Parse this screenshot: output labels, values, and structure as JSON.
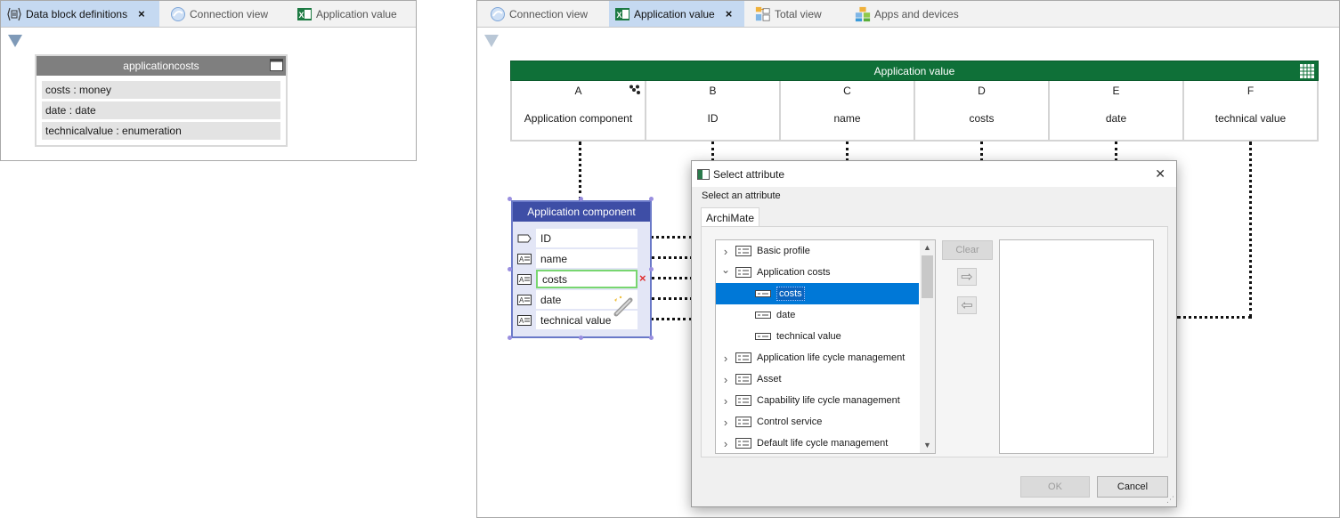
{
  "left_panel": {
    "tabs": [
      {
        "label": "Data block definitions",
        "active": true,
        "close": "×"
      },
      {
        "label": "Connection view",
        "active": false
      },
      {
        "label": "Application value",
        "active": false
      }
    ],
    "data_block": {
      "title": "applicationcosts",
      "rows": [
        "costs : money",
        "date : date",
        "technicalvalue : enumeration"
      ]
    }
  },
  "right_panel": {
    "tabs": [
      {
        "label": "Connection view",
        "active": false
      },
      {
        "label": "Application value",
        "active": true,
        "close": "×"
      },
      {
        "label": "Total view",
        "active": false
      },
      {
        "label": "Apps and devices",
        "active": false
      }
    ],
    "app_value_table": {
      "title": "Application value",
      "columns": [
        {
          "letter": "A",
          "label": "Application component"
        },
        {
          "letter": "B",
          "label": "ID"
        },
        {
          "letter": "C",
          "label": "name"
        },
        {
          "letter": "D",
          "label": "costs"
        },
        {
          "letter": "E",
          "label": "date"
        },
        {
          "letter": "F",
          "label": "technical value"
        }
      ]
    },
    "app_component": {
      "title": "Application component",
      "rows": [
        "ID",
        "name",
        "costs",
        "date",
        "technical value"
      ],
      "selected_row": "costs",
      "remove_mark": "×"
    }
  },
  "dialog": {
    "title": "Select attribute",
    "close": "✕",
    "instruction": "Select an attribute",
    "tab": "ArchiMate",
    "tree": [
      {
        "label": "Basic profile",
        "expander": "›",
        "level": 0
      },
      {
        "label": "Application costs",
        "expander": "⌄",
        "level": 0
      },
      {
        "label": "costs",
        "level": 1,
        "selected": true
      },
      {
        "label": "date",
        "level": 1
      },
      {
        "label": "technical value",
        "level": 1
      },
      {
        "label": "Application life cycle management",
        "expander": "›",
        "level": 0
      },
      {
        "label": "Asset",
        "expander": "›",
        "level": 0
      },
      {
        "label": "Capability life cycle management",
        "expander": "›",
        "level": 0
      },
      {
        "label": "Control service",
        "expander": "›",
        "level": 0
      },
      {
        "label": "Default life cycle management",
        "expander": "›",
        "level": 0
      }
    ],
    "clear_label": "Clear",
    "add_arrow": "⇨",
    "remove_arrow": "⇦",
    "ok_label": "OK",
    "cancel_label": "Cancel"
  },
  "colors": {
    "tab_active": "#c5d9f1",
    "app_value_header": "#0f7038",
    "app_component_header": "#3e4ea6",
    "selection": "#0078d7",
    "selected_row_border": "#78d670"
  }
}
